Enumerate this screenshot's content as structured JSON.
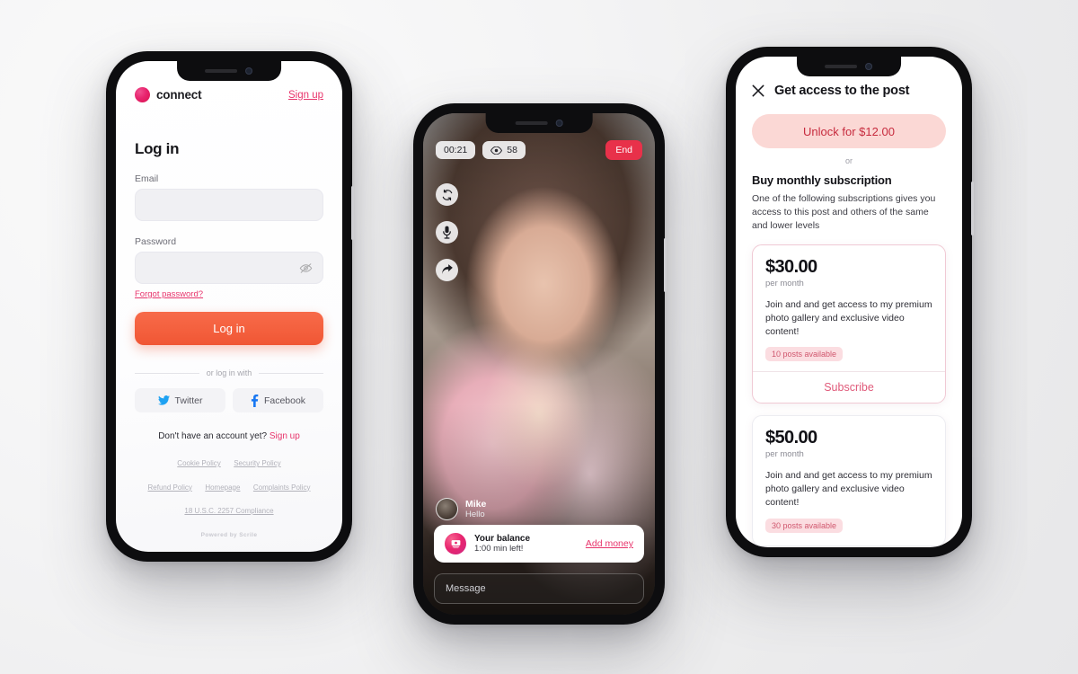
{
  "phone1": {
    "brand": {
      "name": "connect",
      "logo_icon": "brand-dot-icon",
      "color": "#e8246e"
    },
    "signup_top": "Sign up",
    "title": "Log in",
    "email": {
      "label": "Email",
      "value": "",
      "placeholder": ""
    },
    "password": {
      "label": "Password",
      "value": "",
      "placeholder": "",
      "toggle_icon": "eye-off-icon"
    },
    "forgot": "Forgot password?",
    "login_button": "Log in",
    "login_button_color": "#f4603e",
    "divider": "or log in with",
    "social": [
      {
        "label": "Twitter",
        "icon": "twitter-icon",
        "color": "#1da1f2"
      },
      {
        "label": "Facebook",
        "icon": "facebook-icon",
        "color": "#1877f2"
      }
    ],
    "account_prompt": "Don't have an account yet?",
    "account_link": "Sign up",
    "footer_links_row1": [
      "Cookie Policy",
      "Security Policy"
    ],
    "footer_links_row2": [
      "Refund Policy",
      "Homepage",
      "Complaints Policy"
    ],
    "footer_links_row3": [
      "18 U.S.C. 2257 Compliance"
    ],
    "powered_by": "Powered by Scrile"
  },
  "phone2": {
    "timer": "00:21",
    "viewers": "58",
    "viewers_icon": "eye-icon",
    "end_button": "End",
    "end_button_color": "#e8314a",
    "controls": [
      {
        "icon": "flip-camera-icon",
        "name": "flip-camera"
      },
      {
        "icon": "microphone-icon",
        "name": "microphone"
      },
      {
        "icon": "share-icon",
        "name": "share"
      }
    ],
    "chat": {
      "name": "Mike",
      "message": "Hello"
    },
    "balance": {
      "icon": "money-icon",
      "title": "Your balance",
      "subtitle": "1:00 min left!",
      "action": "Add money",
      "action_color": "#e8356c"
    },
    "message_input": {
      "value": "",
      "placeholder": "Message"
    }
  },
  "phone3": {
    "close_icon": "close-icon",
    "title": "Get access to the post",
    "unlock_button": "Unlock for $12.00",
    "unlock_bg": "#fbd8d5",
    "unlock_fg": "#c72b3e",
    "or": "or",
    "subtitle": "Buy monthly subscription",
    "description": "One of the following subscriptions gives you access to this post and others of the same and lower levels",
    "plans": [
      {
        "price": "$30.00",
        "period": "per month",
        "description": "Join and and get access to my premium photo gallery and exclusive video content!",
        "badge": "10 posts available",
        "cta": "Subscribe",
        "highlighted": true
      },
      {
        "price": "$50.00",
        "period": "per month",
        "description": "Join and and get access to my premium photo gallery and exclusive video content!",
        "badge": "30 posts available",
        "cta": "",
        "highlighted": false
      }
    ]
  }
}
